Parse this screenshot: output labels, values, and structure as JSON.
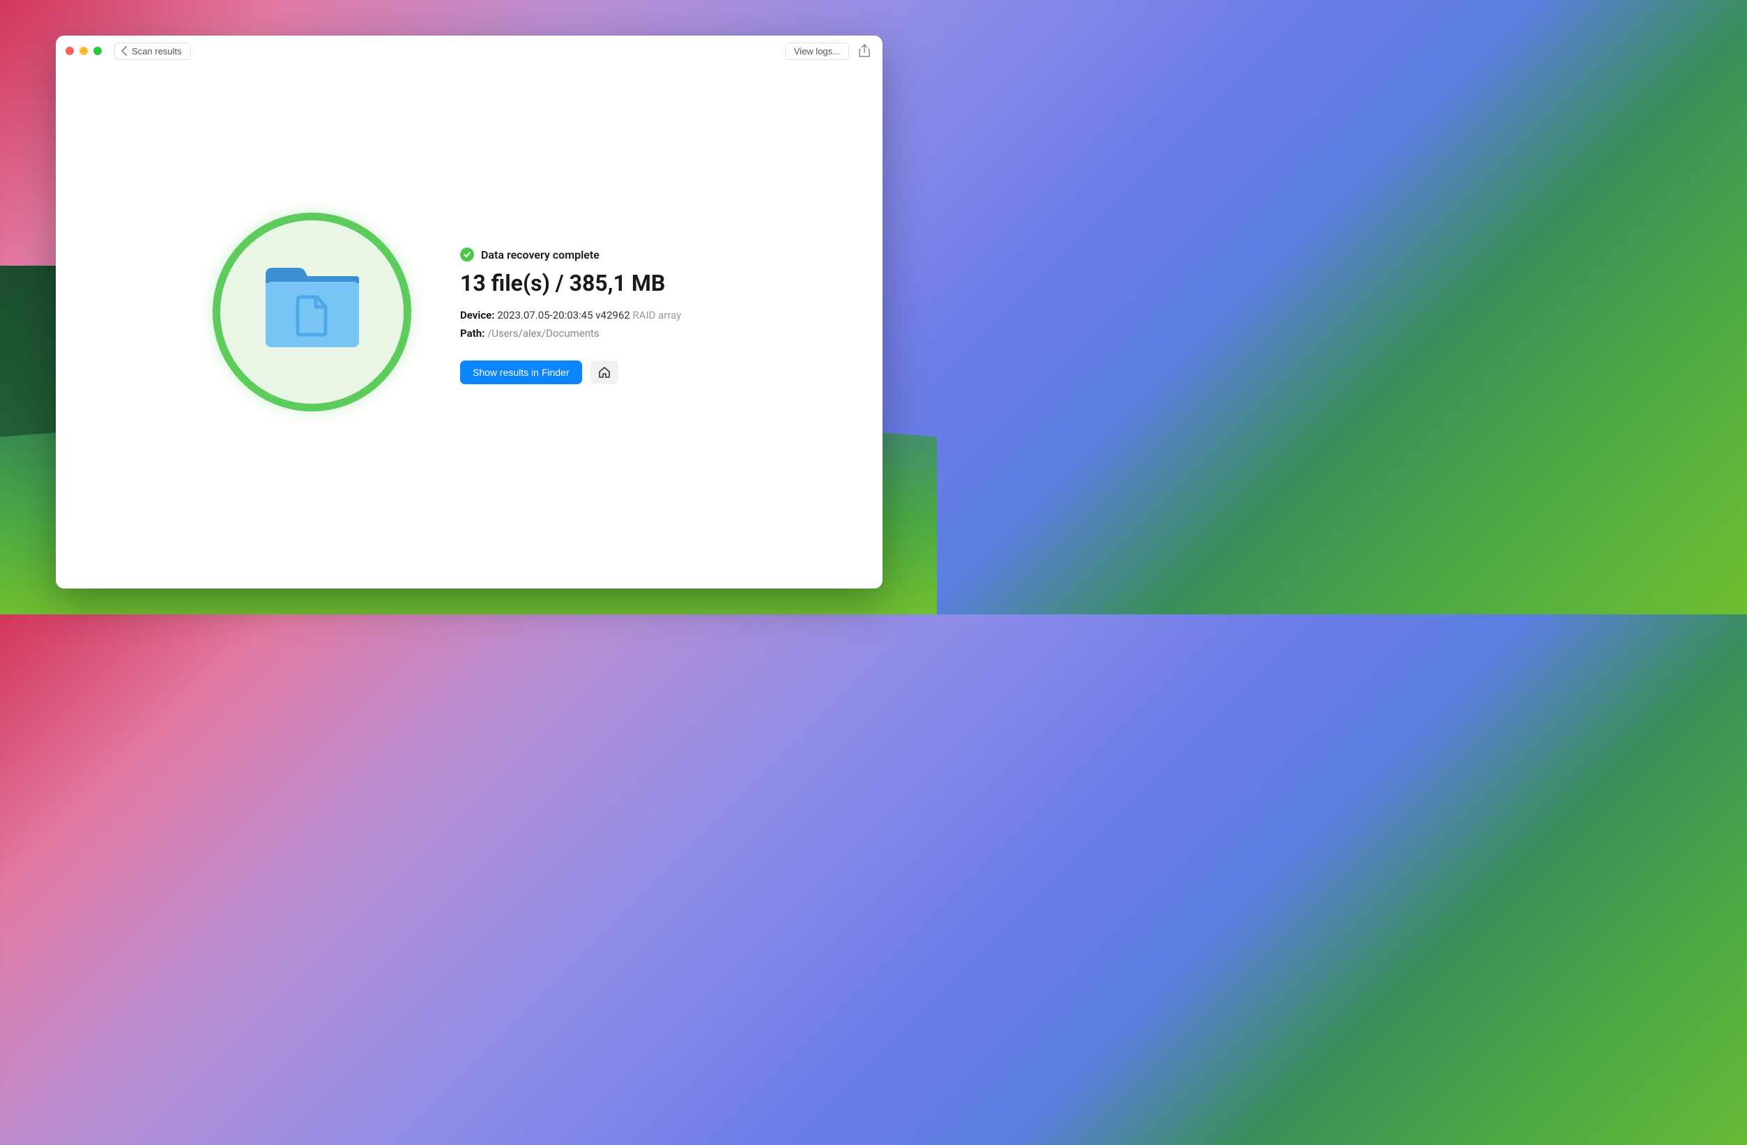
{
  "titlebar": {
    "back_label": "Scan results",
    "view_logs_label": "View logs..."
  },
  "result": {
    "status_text": "Data recovery complete",
    "heading": "13 file(s) / 385,1 MB",
    "device_label": "Device:",
    "device_value": "2023.07.05-20:03:45 v42962",
    "device_type": "RAID array",
    "path_label": "Path:",
    "path_value": "/Users/alex/Documents",
    "primary_button_label": "Show results in Finder"
  }
}
